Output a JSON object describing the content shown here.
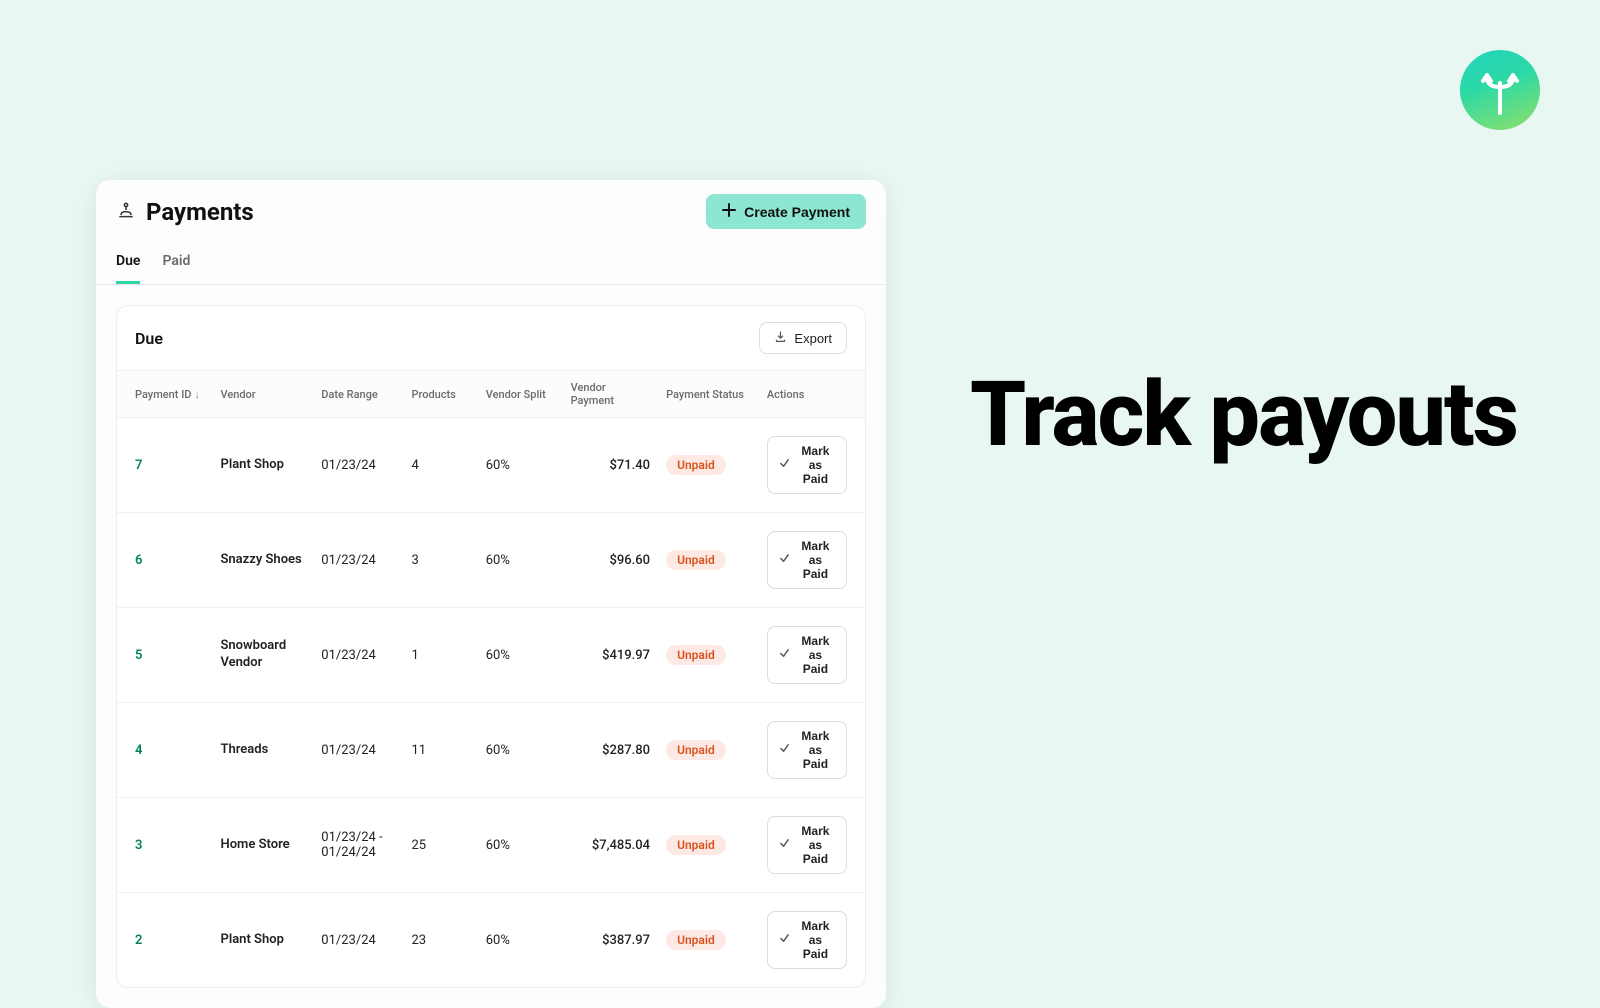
{
  "headline": "Track payouts",
  "header": {
    "title": "Payments",
    "create_label": "Create Payment"
  },
  "tabs": [
    {
      "label": "Due",
      "active": true
    },
    {
      "label": "Paid",
      "active": false
    }
  ],
  "panel": {
    "title": "Due",
    "export_label": "Export"
  },
  "columns": {
    "id": "Payment ID",
    "vendor": "Vendor",
    "date": "Date Range",
    "products": "Products",
    "split": "Vendor Split",
    "payment": "Vendor Payment",
    "status": "Payment Status",
    "actions": "Actions"
  },
  "mark_label": "Mark as Paid",
  "rows": [
    {
      "id": "7",
      "vendor": "Plant Shop",
      "date": "01/23/24",
      "products": "4",
      "split": "60%",
      "payment": "$71.40",
      "status": "Unpaid"
    },
    {
      "id": "6",
      "vendor": "Snazzy Shoes",
      "date": "01/23/24",
      "products": "3",
      "split": "60%",
      "payment": "$96.60",
      "status": "Unpaid"
    },
    {
      "id": "5",
      "vendor": "Snowboard Vendor",
      "date": "01/23/24",
      "products": "1",
      "split": "60%",
      "payment": "$419.97",
      "status": "Unpaid"
    },
    {
      "id": "4",
      "vendor": "Threads",
      "date": "01/23/24",
      "products": "11",
      "split": "60%",
      "payment": "$287.80",
      "status": "Unpaid"
    },
    {
      "id": "3",
      "vendor": "Home Store",
      "date": "01/23/24 - 01/24/24",
      "products": "25",
      "split": "60%",
      "payment": "$7,485.04",
      "status": "Unpaid"
    },
    {
      "id": "2",
      "vendor": "Plant Shop",
      "date": "01/23/24",
      "products": "23",
      "split": "60%",
      "payment": "$387.97",
      "status": "Unpaid"
    }
  ]
}
